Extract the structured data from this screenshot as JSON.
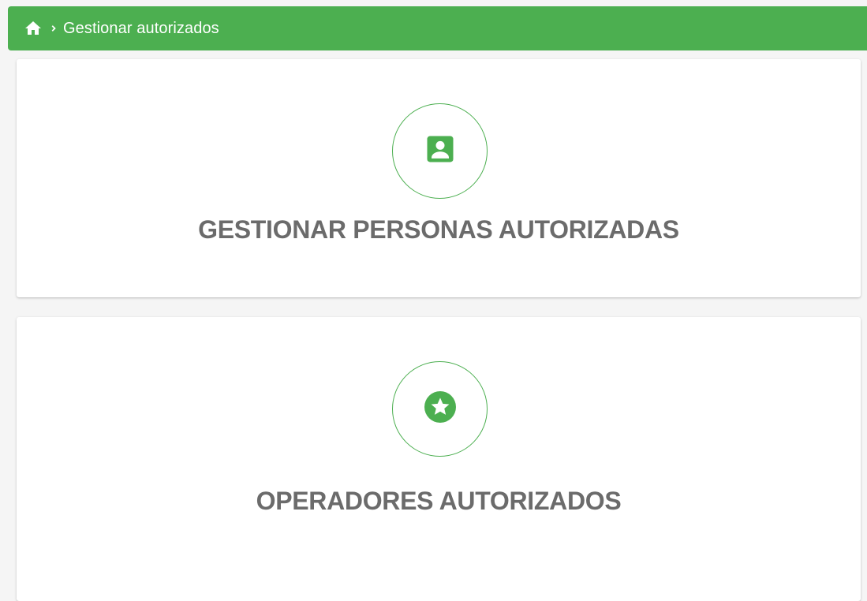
{
  "breadcrumb": {
    "home_icon": "home-icon",
    "separator_icon": "chevron-right-icon",
    "current": "Gestionar autorizados"
  },
  "cards": [
    {
      "icon": "account-box-icon",
      "title": "GESTIONAR PERSONAS AUTORIZADAS"
    },
    {
      "icon": "star-circle-icon",
      "title": "OPERADORES AUTORIZADOS"
    }
  ],
  "colors": {
    "accent": "#4caf50",
    "title_text": "#6b6b6b",
    "card_background": "#ffffff",
    "page_background": "#f5f5f5"
  }
}
